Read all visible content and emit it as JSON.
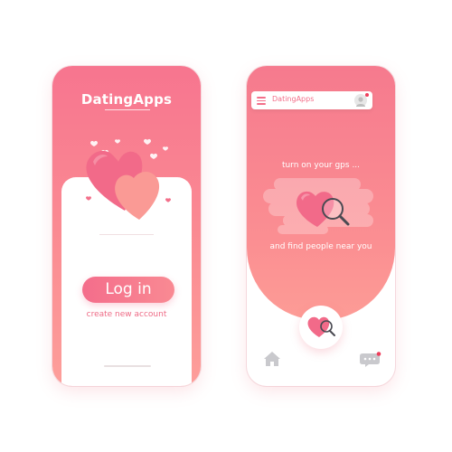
{
  "left_screen": {
    "brand": "DatingApps",
    "login_label": "Log in",
    "create_account_label": "create new account"
  },
  "right_screen": {
    "brand": "DatingApps",
    "gps_prompt": "turn on your gps ...",
    "find_prompt": "and find people near you",
    "nav": {
      "left": "home-icon",
      "center": "heart-search-icon",
      "right": "chat-icon"
    }
  },
  "colors": {
    "primary": "#f6758e",
    "accent": "#fd9e9a",
    "text_on_primary": "#ffffff",
    "link": "#ee6a85",
    "notification": "#ee3e5b"
  }
}
